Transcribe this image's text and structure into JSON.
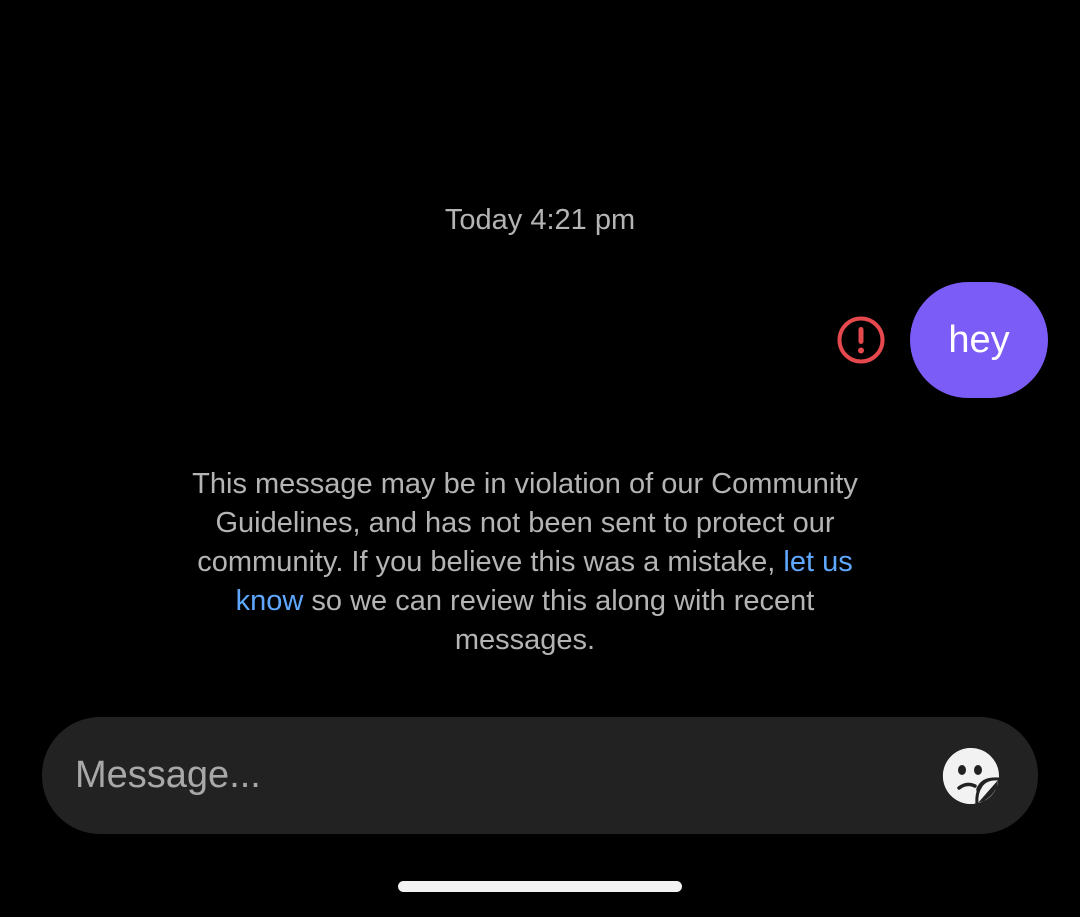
{
  "conversation": {
    "timestamp": "Today 4:21 pm",
    "messages": [
      {
        "text": "hey",
        "direction": "outgoing",
        "status_icon": "error-exclamation-icon",
        "status_color": "#e5484d",
        "bubble_color": "#7b5cf6"
      }
    ]
  },
  "violation_notice": {
    "text_before_link": "This message may be in violation of our Community Guidelines, and has not been sent to protect our community. If you believe this was a mistake, ",
    "link_text": "let us know",
    "text_after_link": " so we can review this along with recent messages.",
    "link_color": "#5fa8ff"
  },
  "composer": {
    "placeholder": "Message...",
    "value": "",
    "sticker_icon": "sticker-face-icon"
  }
}
